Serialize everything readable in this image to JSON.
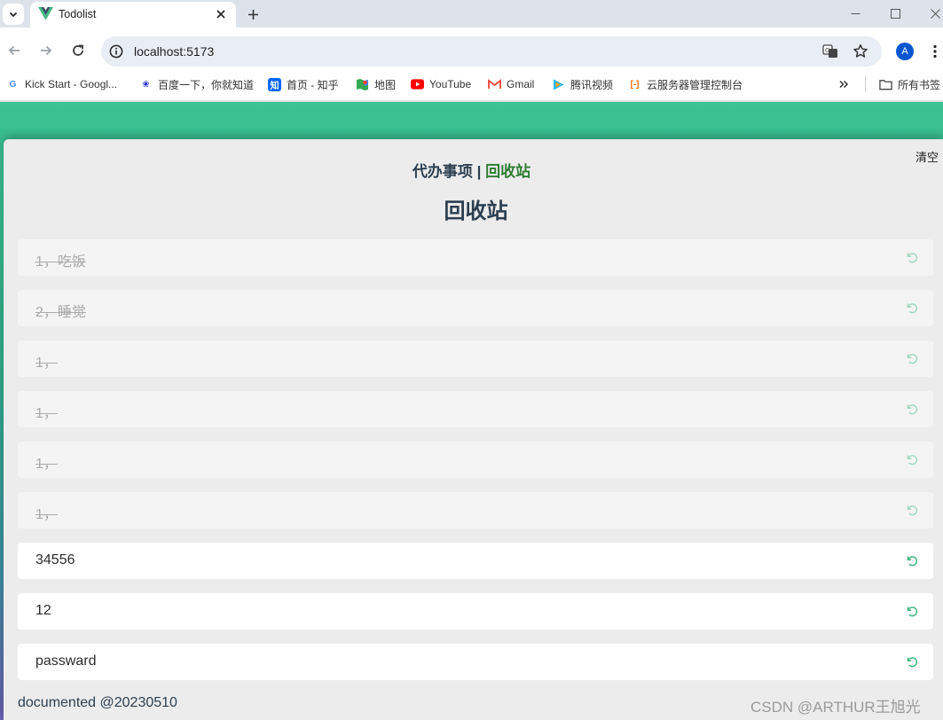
{
  "browser": {
    "tab_title": "Todolist",
    "url": "localhost:5173",
    "avatar_letter": "A",
    "bookmarks": [
      {
        "label": "Kick Start - Googl...",
        "icon": "google-icon",
        "color": "#4285f4"
      },
      {
        "label": "百度一下，你就知道",
        "icon": "baidu-icon",
        "color": "#2932e1"
      },
      {
        "label": "首页 - 知乎",
        "icon": "zhihu-icon",
        "color": "#0066ff"
      },
      {
        "label": "地图",
        "icon": "maps-icon",
        "color": "#34a853"
      },
      {
        "label": "YouTube",
        "icon": "youtube-icon",
        "color": "#ff0000"
      },
      {
        "label": "Gmail",
        "icon": "gmail-icon",
        "color": "#ea4335"
      },
      {
        "label": "腾讯视频",
        "icon": "tencent-video-icon",
        "color": "#20b8ff"
      },
      {
        "label": "云服务器管理控制台",
        "icon": "aliyun-icon",
        "color": "#ff6a00"
      }
    ],
    "all_bookmarks_label": "所有书签"
  },
  "app": {
    "clear_label": "清空",
    "nav": {
      "todo": "代办事项",
      "separator": "|",
      "recycle": "回收站"
    },
    "title": "回收站",
    "items": [
      {
        "text": "1，吃饭",
        "done": true
      },
      {
        "text": "2，睡觉",
        "done": true
      },
      {
        "text": "1，",
        "done": true
      },
      {
        "text": "1，",
        "done": true
      },
      {
        "text": "1，",
        "done": true
      },
      {
        "text": "1，",
        "done": true
      },
      {
        "text": "34556",
        "done": false
      },
      {
        "text": "12",
        "done": false
      },
      {
        "text": "passward",
        "done": false
      }
    ],
    "footer": "documented @20230510",
    "accent_color": "#42b883"
  },
  "watermark": "CSDN @ARTHUR王旭光"
}
